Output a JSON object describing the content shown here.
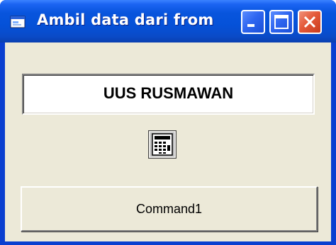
{
  "window": {
    "title": "Ambil data dari from",
    "icon": "form-icon",
    "controls": {
      "minimize": "minimize-icon",
      "maximize": "maximize-icon",
      "close": "close-icon"
    }
  },
  "form": {
    "text1_value": "UUS RUSMAWAN",
    "picture_icon": "calculator-icon",
    "command1_label": "Command1"
  },
  "colors": {
    "titlebar": "#0855dd",
    "client": "#ece9d8",
    "close_button": "#e45a3a"
  }
}
